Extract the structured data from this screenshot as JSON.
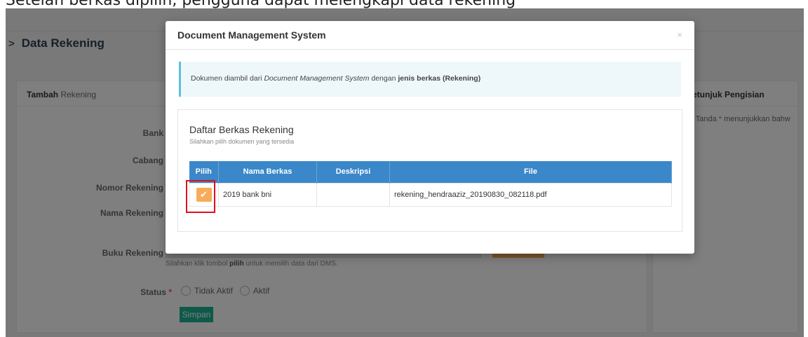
{
  "caption": "Setelah berkas dipilih, pengguna dapat melengkapi data rekening",
  "page": {
    "header_title": "Data Rekening",
    "left_panel": {
      "head_bold": "Tambah",
      "head_rest": " Rekening",
      "fields": [
        "Bank",
        "Cabang",
        "Nomor Rekening",
        "Nama Rekening",
        "Buku Rekening"
      ],
      "status_label": "Status",
      "required_mark": "*",
      "helper_prefix": "Silahkan klik tombol ",
      "helper_bold": "pilih",
      "helper_suffix": " untuk memilih data dari DMS.",
      "radio_options": [
        "Tidak Aktif",
        "Aktif"
      ],
      "submit_label": "Simpan"
    },
    "right_panel": {
      "head": "etunjuk Pengisian",
      "bullet": "•",
      "item_prefix": "Tanda ",
      "item_mark": "*",
      "item_suffix": " menunjukkan bahw"
    }
  },
  "modal": {
    "title": "Document Management System",
    "close": "×",
    "alert": {
      "prefix": "Dokumen diambil dari ",
      "italic": "Document Management System",
      "middle": " dengan ",
      "bold": "jenis berkas (Rekening)"
    },
    "card": {
      "title": "Daftar Berkas Rekening",
      "subtitle": "Silahkan pilih dokumen yang tersedia"
    },
    "table": {
      "headers": [
        "Pilih",
        "Nama Berkas",
        "Deskripsi",
        "File"
      ],
      "rows": [
        {
          "nama": "2019 bank bni",
          "deskripsi": "",
          "file": "rekening_hendraaziz_20190830_082118.pdf"
        }
      ]
    },
    "check_glyph": "✔"
  },
  "colors": {
    "accent_blue": "#3a87c9",
    "check_orange": "#f8ac59",
    "highlight_red": "#e0101a",
    "info_border": "#5bc0de"
  }
}
